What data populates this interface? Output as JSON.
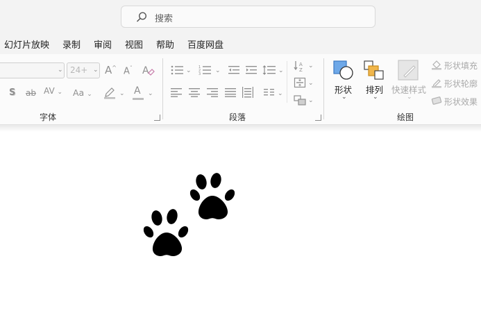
{
  "search": {
    "placeholder": "搜索"
  },
  "menu": {
    "items": [
      {
        "label": "幻灯片放映"
      },
      {
        "label": "录制"
      },
      {
        "label": "审阅"
      },
      {
        "label": "视图"
      },
      {
        "label": "帮助"
      },
      {
        "label": "百度网盘"
      }
    ]
  },
  "ribbon": {
    "font_group": {
      "label": "字体",
      "font_size_value": "24+",
      "grow_label": "A",
      "shrink_label": "A",
      "shadow_label": "S",
      "strike_label": "ab",
      "spacing_label": "AV",
      "case_label": "Aa",
      "color_label": "A"
    },
    "paragraph_group": {
      "label": "段落"
    },
    "drawing_group": {
      "label": "绘图",
      "shapes_label": "形状",
      "arrange_label": "排列",
      "quick_styles_label": "快速样式",
      "shape_fill_label": "形状填充",
      "shape_outline_label": "形状轮廓",
      "shape_effects_label": "形状效果"
    }
  },
  "colors": {
    "accent_blue": "#4a90d9",
    "arrange_orange": "#f0b64b",
    "disabled_gray": "#a9a9a9"
  },
  "icons": [
    "search-icon",
    "paw-print-icon",
    "shapes-icon",
    "arrange-icon",
    "quick-styles-icon",
    "shape-fill-icon",
    "shape-outline-icon",
    "shape-effects-icon"
  ]
}
